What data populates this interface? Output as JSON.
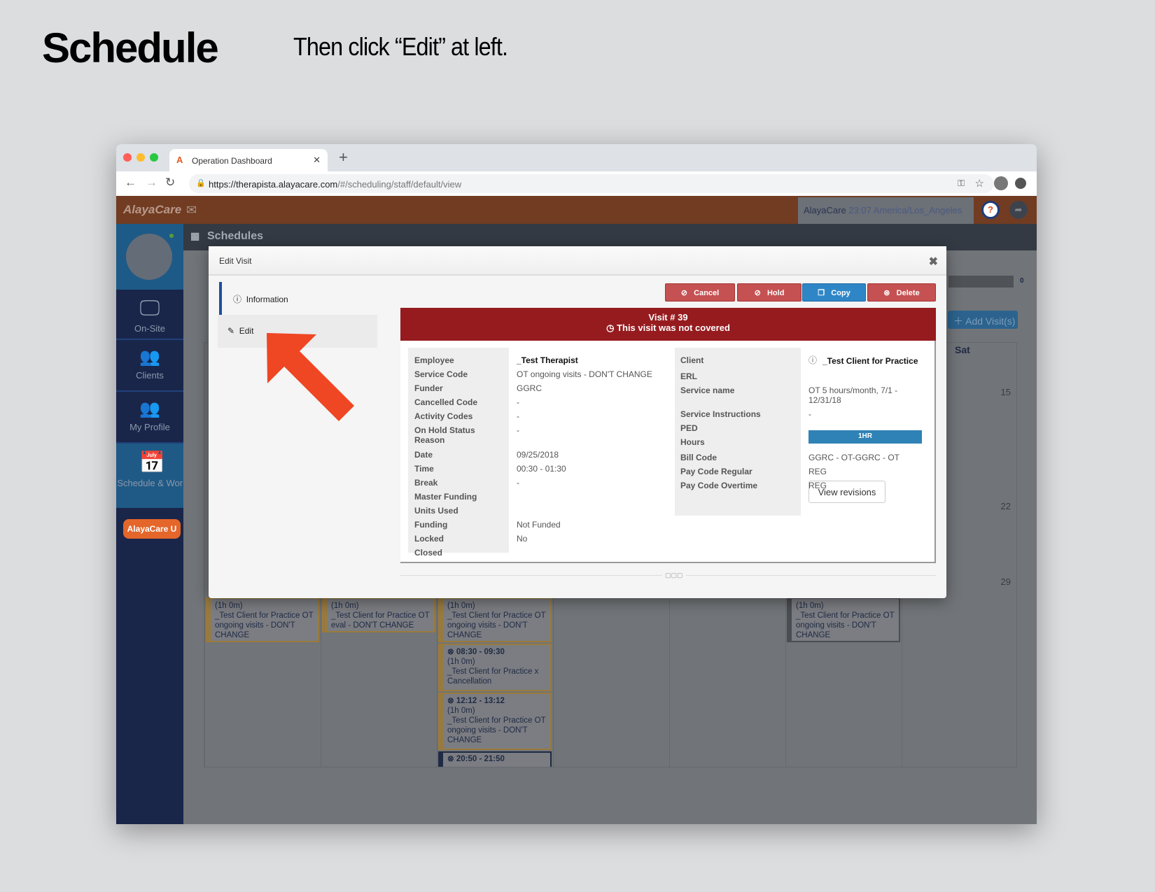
{
  "heading": {
    "title": "Schedule",
    "instruction": "Then click “Edit” at left."
  },
  "browser": {
    "tab_title": "Operation Dashboard",
    "url_host": "https://therapista.alayacare.com",
    "url_path": "/#/scheduling/staff/default/view"
  },
  "app": {
    "logo": "AlayaCare",
    "header_info": "AlayaCare",
    "time": "23:07",
    "timezone": "America/Los_Angeles",
    "section": "Schedules",
    "sidebar": [
      {
        "label": "On-Site",
        "icon": "monitor-icon"
      },
      {
        "label": "Clients",
        "icon": "users-icon"
      },
      {
        "label": "My Profile",
        "icon": "team-icon"
      },
      {
        "label": "Schedule & Work",
        "icon": "calendar-icon"
      }
    ],
    "alayacare_u": "AlayaCare U",
    "add_visits": "Add Visit(s)",
    "progress_count": "0",
    "day_header": "Sat",
    "dates": [
      "15",
      "22",
      "29"
    ]
  },
  "calendar_events": [
    {
      "duration": "(1h 0m)",
      "text": "_Test Client for Practice OT ongoing visits - DON'T CHANGE"
    },
    {
      "duration": "(1h 0m)",
      "text": "_Test Client for Practice OT eval - DON'T CHANGE"
    },
    {
      "duration": "(1h 0m)",
      "text": "_Test Client for Practice OT ongoing visits - DON'T CHANGE"
    },
    {
      "time": "08:30 - 09:30",
      "duration": "(1h 0m)",
      "text": "_Test Client for Practice x Cancellation"
    },
    {
      "time": "12:12 - 13:12",
      "duration": "(1h 0m)",
      "text": "_Test Client for Practice OT ongoing visits - DON'T CHANGE"
    },
    {
      "time": "20:50 - 21:50"
    },
    {
      "duration": "(1h 0m)",
      "text": "_Test Client for Practice OT ongoing visits - DON'T CHANGE"
    }
  ],
  "modal": {
    "title": "Edit Visit",
    "nav": {
      "information": "Information",
      "edit": "Edit"
    },
    "buttons": {
      "cancel": "Cancel",
      "hold": "Hold",
      "copy": "Copy",
      "delete": "Delete"
    },
    "banner": {
      "visit": "Visit # 39",
      "status": "This visit was not covered"
    },
    "left_fields": [
      {
        "label": "Employee",
        "value": "_Test Therapist"
      },
      {
        "label": "Service Code",
        "value": "OT ongoing visits - DON'T CHANGE"
      },
      {
        "label": "Funder",
        "value": "GGRC"
      },
      {
        "label": "Cancelled Code",
        "value": "-"
      },
      {
        "label": "Activity Codes",
        "value": "-"
      },
      {
        "label": "On Hold Status Reason",
        "value": "-"
      },
      {
        "label": "Date",
        "value": "09/25/2018"
      },
      {
        "label": "Time",
        "value": "00:30  -  01:30"
      },
      {
        "label": "Break",
        "value": "-"
      },
      {
        "label": "Master Funding",
        "value": ""
      },
      {
        "label": "Units Used",
        "value": ""
      },
      {
        "label": "Funding",
        "value": "Not Funded"
      },
      {
        "label": "Locked",
        "value": "No"
      },
      {
        "label": "Closed",
        "value": ""
      }
    ],
    "right_fields": [
      {
        "label": "Client",
        "value": "_Test Client for Practice"
      },
      {
        "label": "ERL",
        "value": ""
      },
      {
        "label": "Service name",
        "value": "OT 5 hours/month, 7/1 - 12/31/18"
      },
      {
        "label": "Service Instructions",
        "value": "-"
      },
      {
        "label": "PED",
        "value": ""
      },
      {
        "label": "Hours",
        "value": "1HR"
      },
      {
        "label": "Bill Code",
        "value": "GGRC - OT-GGRC - OT"
      },
      {
        "label": "Pay Code Regular",
        "value": "REG"
      },
      {
        "label": "Pay Code Overtime",
        "value": "REG"
      }
    ],
    "view_revisions": "View revisions"
  },
  "colors": {
    "banner": "#961b1f",
    "danger_button": "#c55152",
    "primary_button": "#2f86c7",
    "arrow": "#ef4623"
  }
}
